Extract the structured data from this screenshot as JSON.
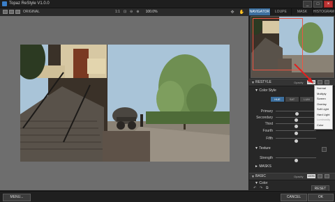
{
  "window": {
    "title": "Topaz ReStyle V1.0.0"
  },
  "toolbar": {
    "original_label": "ORIGINAL",
    "zoom_one_to_one": "1:1",
    "zoom": "100.0%",
    "fit_label": "⊡"
  },
  "panel_tabs": [
    "NAVIGATOR",
    "LOUPE",
    "MASK",
    "HISTOGRAM"
  ],
  "restyle": {
    "label": "RESTYLE",
    "opacity_label": "Opacity",
    "opacity_value": "100%",
    "color_style": {
      "label": "Color Style",
      "tabs": [
        "HUE",
        "SAT",
        "LUM"
      ],
      "active_tab": "HUE",
      "sliders": [
        {
          "label": "Primary",
          "value": 0.53
        },
        {
          "label": "Secondary",
          "value": 0.5
        },
        {
          "label": "Third",
          "value": 0.5
        },
        {
          "label": "Fourth",
          "value": 0.5
        },
        {
          "label": "Fifth",
          "value": 0.5
        }
      ]
    },
    "texture": {
      "label": "Texture",
      "strength_label": "Strength",
      "strength_value": 0.5
    },
    "masks_label": "MASKS"
  },
  "blend_dropdown": {
    "items": [
      "Normal",
      "Multiply",
      "Screen",
      "Overlay",
      "Soft Light",
      "Hard Light",
      "Luminosity",
      "Color"
    ],
    "muted_index": 6
  },
  "basic": {
    "label": "BASIC",
    "opacity_label": "Opacity",
    "opacity_value": "100%",
    "sub_label": "Color"
  },
  "footer": {
    "menu_label": "MENU...",
    "cancel_label": "CANCEL",
    "ok_label": "OK"
  },
  "reset_label": "RESET",
  "colors": {
    "accent": "#3c6f9e",
    "arrow": "#e02020"
  }
}
